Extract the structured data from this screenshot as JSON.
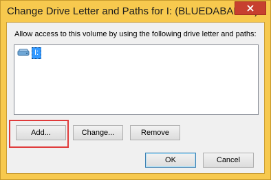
{
  "window": {
    "title": "Change Drive Letter and Paths for I: (BLUEDABADEE)",
    "close_icon": "close-icon"
  },
  "dialog": {
    "instruction": "Allow access to this volume by using the following drive letter and paths:",
    "list_items": [
      {
        "icon": "drive-icon",
        "label": "I:",
        "selected": true
      }
    ],
    "buttons": {
      "add": "Add...",
      "change": "Change...",
      "remove": "Remove",
      "ok": "OK",
      "cancel": "Cancel"
    }
  },
  "colors": {
    "title_bar": "#f7c94e",
    "close_button": "#c7402f",
    "selection": "#3399ff",
    "highlight": "#e03a3a"
  }
}
